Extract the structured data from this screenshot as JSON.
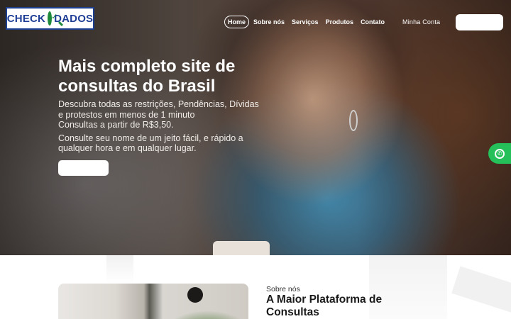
{
  "brand": {
    "logo_left": "CHECK",
    "logo_right": "DADOS",
    "colors": {
      "logo_blue": "#1f3f96",
      "logo_green": "#1e8a3a",
      "whatsapp": "#25c05a"
    }
  },
  "nav": {
    "items": [
      {
        "label": "Home",
        "active": true
      },
      {
        "label": "Sobre nós",
        "active": false
      },
      {
        "label": "Serviços",
        "active": false
      },
      {
        "label": "Produtos",
        "active": false
      },
      {
        "label": "Contato",
        "active": false
      }
    ],
    "account_label": "Minha Conta"
  },
  "hero": {
    "title": "Mais completo site de consultas do Brasil",
    "line1": "Descubra todas as restrições, Pendências, Dívidas e protestos em menos de 1 minuto",
    "line2": "Consultas a partir de R$3,50.",
    "line3": "Consulte seu nome de um jeito fácil, e rápido a qualquer hora e em qualquer lugar."
  },
  "floating": {
    "icon": "whatsapp-icon"
  },
  "about": {
    "kicker": "Sobre nós",
    "title": "A Maior Plataforma de Consultas"
  }
}
